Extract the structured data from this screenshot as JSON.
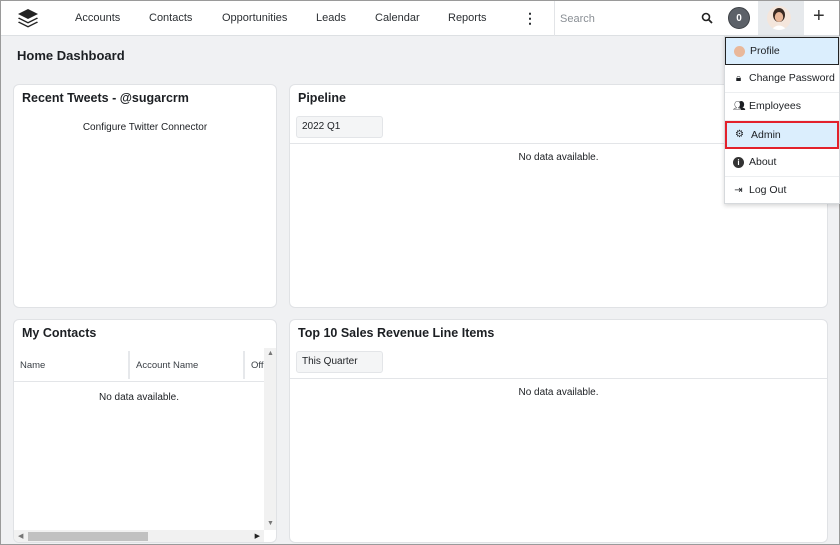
{
  "nav": {
    "items": [
      "Accounts",
      "Contacts",
      "Opportunities",
      "Leads",
      "Calendar",
      "Reports"
    ],
    "search_placeholder": "Search",
    "notification_count": "0"
  },
  "page": {
    "title": "Home Dashboard"
  },
  "dashlets": {
    "tweets": {
      "title": "Recent Tweets - @sugarcrm",
      "message": "Configure Twitter Connector"
    },
    "pipeline": {
      "title": "Pipeline",
      "filter": "2022 Q1",
      "message": "No data available."
    },
    "contacts": {
      "title": "My Contacts",
      "columns": [
        "Name",
        "Account Name",
        "Off"
      ],
      "message": "No data available."
    },
    "revenue": {
      "title": "Top 10 Sales Revenue Line Items",
      "filter": "This Quarter",
      "message": "No data available."
    }
  },
  "user_menu": {
    "items": [
      "Profile",
      "Change Password",
      "Employees",
      "Admin",
      "About",
      "Log Out"
    ]
  },
  "colors": {
    "highlight": "#dbeefd",
    "focus_border": "#e3212b"
  }
}
